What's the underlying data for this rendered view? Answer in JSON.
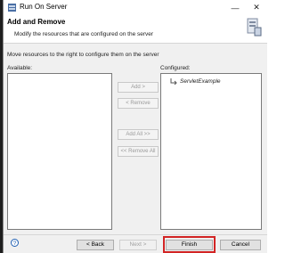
{
  "window": {
    "title": "Run On Server"
  },
  "header": {
    "title": "Add and Remove",
    "subtitle": "Modify the resources that are configured on the server"
  },
  "instructions": "Move resources to the right to configure them on the server",
  "available": {
    "label": "Available:",
    "items": []
  },
  "configured": {
    "label": "Configured:",
    "items": [
      "ServletExample"
    ]
  },
  "transfer_buttons": {
    "add": "Add >",
    "remove": "< Remove",
    "add_all": "Add All >>",
    "remove_all": "<< Remove All"
  },
  "footer": {
    "back": "< Back",
    "next": "Next >",
    "finish": "Finish",
    "cancel": "Cancel",
    "help_icon": "?"
  },
  "colors": {
    "highlight": "#d22424",
    "accent": "#1f5fb3"
  }
}
